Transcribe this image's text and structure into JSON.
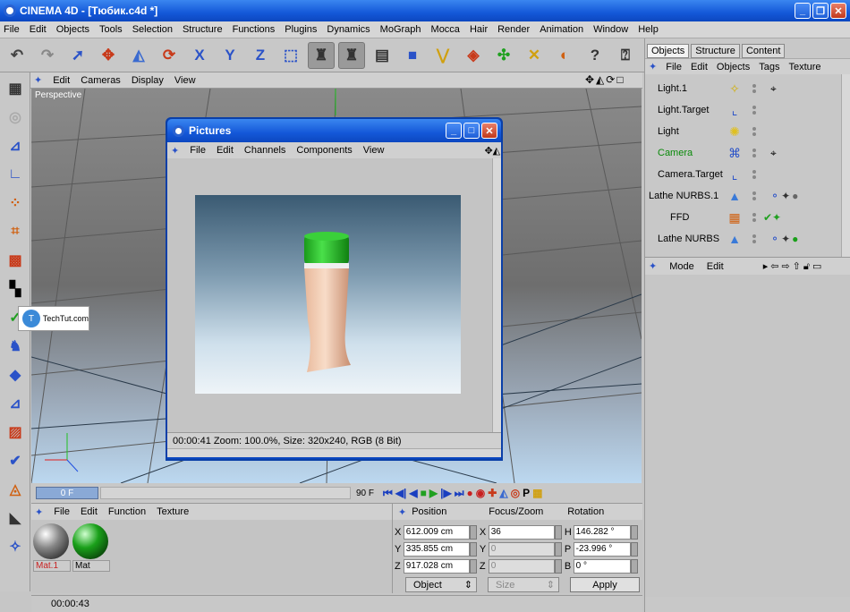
{
  "app": {
    "title": "CINEMA 4D - [Тюбик.c4d *]"
  },
  "menu": [
    "File",
    "Edit",
    "Objects",
    "Tools",
    "Selection",
    "Structure",
    "Functions",
    "Plugins",
    "Dynamics",
    "MoGraph",
    "Mocca",
    "Hair",
    "Render",
    "Animation",
    "Window",
    "Help"
  ],
  "viewport": {
    "menu": [
      "Edit",
      "Cameras",
      "Display",
      "View"
    ],
    "label": "Perspective"
  },
  "watermark": {
    "text": "TechTut.com"
  },
  "pictures": {
    "title": "Pictures",
    "menu": [
      "File",
      "Edit",
      "Channels",
      "Components",
      "View"
    ],
    "status": "00:00:41   Zoom: 100.0%, Size: 320x240, RGB (8 Bit)"
  },
  "timeline": {
    "current": "0 F",
    "end": "90 F"
  },
  "materials": {
    "menu": [
      "File",
      "Edit",
      "Function",
      "Texture"
    ],
    "items": [
      {
        "name": "Mat.1",
        "color": "#888888"
      },
      {
        "name": "Mat",
        "color": "#1aa01a"
      }
    ]
  },
  "coords": {
    "headers": [
      "Position",
      "Focus/Zoom",
      "Rotation"
    ],
    "rows": [
      {
        "l1": "X",
        "v1": "612.009 cm",
        "l2": "X",
        "v2": "36",
        "l3": "H",
        "v3": "146.282 °"
      },
      {
        "l1": "Y",
        "v1": "335.855 cm",
        "l2": "Y",
        "v2": "0",
        "l3": "P",
        "v3": "-23.996 °"
      },
      {
        "l1": "Z",
        "v1": "917.028 cm",
        "l2": "Z",
        "v2": "0",
        "l3": "B",
        "v3": "0 °"
      }
    ],
    "mode_select": "Object",
    "size_select": "Size",
    "apply": "Apply"
  },
  "status": {
    "time": "00:00:43"
  },
  "objects": {
    "tabs": [
      "Objects",
      "Structure",
      "Content"
    ],
    "menu": [
      "File",
      "Edit",
      "Objects",
      "Tags",
      "Texture"
    ],
    "items": [
      {
        "name": "Light.1",
        "icon": "✧"
      },
      {
        "name": "Light.Target",
        "icon": "⌞"
      },
      {
        "name": "Light",
        "icon": "✺"
      },
      {
        "name": "Camera",
        "icon": "⌘"
      },
      {
        "name": "Camera.Target",
        "icon": "⌞"
      },
      {
        "name": "Lathe NURBS.1",
        "icon": "▲"
      },
      {
        "name": "FFD",
        "icon": "▦"
      },
      {
        "name": "Lathe NURBS",
        "icon": "▲"
      }
    ]
  },
  "attributes": {
    "menu": [
      "Mode",
      "Edit"
    ]
  }
}
